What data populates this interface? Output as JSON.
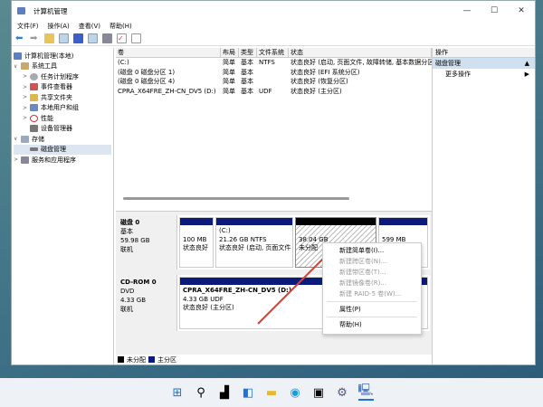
{
  "window": {
    "title": "计算机管理",
    "minimize": "—",
    "maximize": "☐",
    "close": "✕"
  },
  "menu": [
    "文件(F)",
    "操作(A)",
    "查看(V)",
    "帮助(H)"
  ],
  "tree": [
    {
      "label": "计算机管理(本地)",
      "arrow": ""
    },
    {
      "label": "系统工具",
      "arrow": "∨"
    },
    {
      "label": "任务计划程序",
      "arrow": ">"
    },
    {
      "label": "事件查看器",
      "arrow": ">"
    },
    {
      "label": "共享文件夹",
      "arrow": ">"
    },
    {
      "label": "本地用户和组",
      "arrow": ">"
    },
    {
      "label": "性能",
      "arrow": ">"
    },
    {
      "label": "设备管理器",
      "arrow": ""
    },
    {
      "label": "存储",
      "arrow": "∨"
    },
    {
      "label": "磁盘管理",
      "arrow": ""
    },
    {
      "label": "服务和应用程序",
      "arrow": ">"
    }
  ],
  "volumes": {
    "headers": [
      "卷",
      "布局",
      "类型",
      "文件系统",
      "状态"
    ],
    "rows": [
      [
        "(C:)",
        "简单",
        "基本",
        "NTFS",
        "状态良好 (启动, 页面文件, 故障转储, 基本数据分区)"
      ],
      [
        "(磁盘 0 磁盘分区 1)",
        "简单",
        "基本",
        "",
        "状态良好 (EFI 系统分区)"
      ],
      [
        "(磁盘 0 磁盘分区 4)",
        "简单",
        "基本",
        "",
        "状态良好 (恢复分区)"
      ],
      [
        "CPRA_X64FRE_ZH-CN_DV5 (D:)",
        "简单",
        "基本",
        "UDF",
        "状态良好 (主分区)"
      ]
    ]
  },
  "disk0": {
    "name": "磁盘 0",
    "type": "基本",
    "size": "59.98 GB",
    "status": "联机",
    "partitions": [
      {
        "title": "",
        "size": "100 MB",
        "status": "状态良好"
      },
      {
        "title": "(C:)",
        "size": "21.26 GB NTFS",
        "status": "状态良好 (启动, 页面文件"
      },
      {
        "title": "",
        "size": "38.04 GB",
        "status": "未分配"
      },
      {
        "title": "",
        "size": "599 MB",
        "status": ""
      }
    ]
  },
  "cdrom": {
    "name": "CD-ROM 0",
    "type": "DVD",
    "size": "4.33 GB",
    "status": "联机",
    "partition": {
      "title": "CPRA_X64FRE_ZH-CN_DV5  (D:)",
      "size": "4.33 GB UDF",
      "status": "状态良好 (主分区)"
    }
  },
  "legend": [
    "未分配",
    "主分区"
  ],
  "colors": {
    "unallocated": "#000000",
    "primary": "#0c1a7a",
    "arrow": "#e83a2e"
  },
  "actions": {
    "header": "操作",
    "section": "磁盘管理",
    "more": "更多操作"
  },
  "context_menu": [
    {
      "label": "新建简单卷(I)...",
      "enabled": true
    },
    {
      "label": "新建跨区卷(N)...",
      "enabled": false
    },
    {
      "label": "新建带区卷(T)...",
      "enabled": false
    },
    {
      "label": "新建镜像卷(R)...",
      "enabled": false
    },
    {
      "label": "新建 RAID-5 卷(W)...",
      "enabled": false
    },
    {
      "label": "属性(P)",
      "enabled": true
    },
    {
      "label": "帮助(H)",
      "enabled": true
    }
  ],
  "taskbar": [
    "start-icon",
    "search-icon",
    "task-view-icon",
    "widgets-icon",
    "file-explorer-icon",
    "edge-icon",
    "store-icon",
    "settings-icon",
    "computer-management-icon"
  ]
}
